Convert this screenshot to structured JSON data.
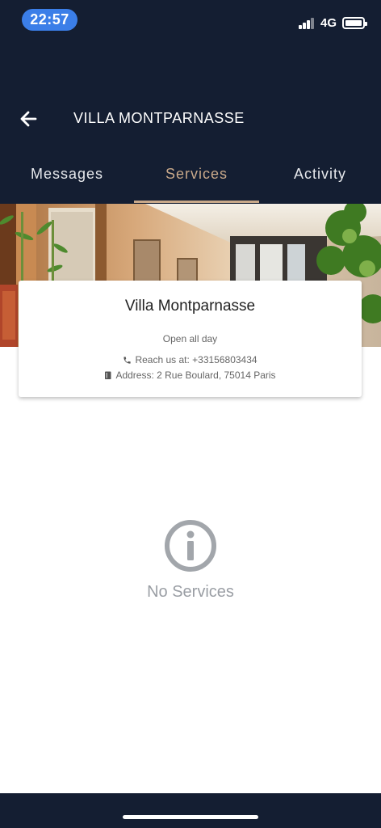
{
  "status_bar": {
    "time": "22:57",
    "network": "4G",
    "icons": [
      "signal-icon",
      "battery-icon"
    ]
  },
  "header": {
    "title": "VILLA MONTPARNASSE",
    "back_icon": "arrow-left-icon"
  },
  "tabs": [
    {
      "label": "Messages",
      "active": false
    },
    {
      "label": "Services",
      "active": true
    },
    {
      "label": "Activity",
      "active": false
    }
  ],
  "colors": {
    "header_bg": "#141e32",
    "accent": "#c9a98a",
    "time_pill": "#3b7ee8",
    "muted": "#9a9ea4"
  },
  "hotel": {
    "name": "Villa Montparnasse",
    "hours": "Open all day",
    "phone": "Reach us at: +33156803434",
    "address": "Address: 2 Rue Boulard, 75014 Paris",
    "phone_icon": "phone-icon",
    "address_icon": "book-icon"
  },
  "empty_state": {
    "icon": "info-circle-icon",
    "text": "No Services"
  }
}
